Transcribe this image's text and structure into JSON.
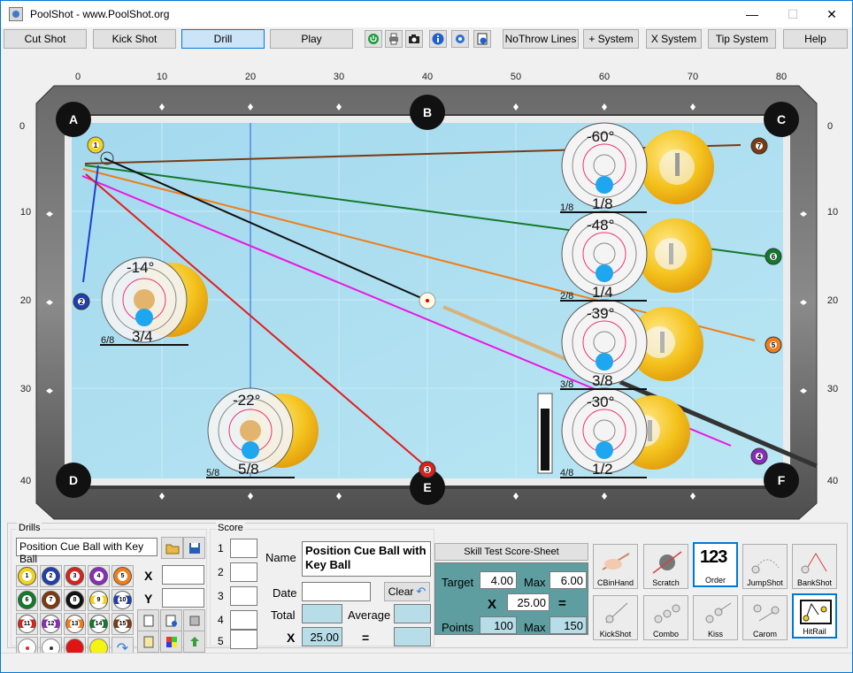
{
  "window": {
    "title": "PoolShot - www.PoolShot.org",
    "minimize": "—",
    "maximize": "☐",
    "close": "✕"
  },
  "toolbar": {
    "buttons": [
      "Cut Shot",
      "Kick Shot",
      "Drill",
      "Play"
    ],
    "active": "Drill",
    "icons": [
      "power-icon",
      "printer-icon",
      "camera-icon",
      "info-icon",
      "settings-icon",
      "help-document-icon"
    ],
    "right_buttons": [
      "NoThrow Lines",
      "+ System",
      "X System",
      "Tip System",
      "Help"
    ]
  },
  "table": {
    "top_ruler": [
      "0",
      "10",
      "20",
      "30",
      "40",
      "50",
      "60",
      "70",
      "80"
    ],
    "left_ruler": [
      "0",
      "10",
      "20",
      "30",
      "40"
    ],
    "right_ruler": [
      "0",
      "10",
      "20",
      "30",
      "40"
    ],
    "pockets": [
      "A",
      "B",
      "C",
      "D",
      "E",
      "F"
    ],
    "balls": [
      {
        "num": "1",
        "color": "#f2d31b"
      },
      {
        "num": "7",
        "color": "#7a3b12"
      },
      {
        "num": "6",
        "color": "#127a2b"
      },
      {
        "num": "2",
        "color": "#1f3fae"
      },
      {
        "num": "5",
        "color": "#f07d17"
      },
      {
        "num": "4",
        "color": "#8b2bbd"
      },
      {
        "num": "3",
        "color": "#d8231d"
      }
    ],
    "aims": [
      {
        "angle": "-60°",
        "frac": "1/8",
        "small": "1/8"
      },
      {
        "angle": "-48°",
        "frac": "1/4",
        "small": "2/8"
      },
      {
        "angle": "-39°",
        "frac": "3/8",
        "small": "3/8"
      },
      {
        "angle": "-30°",
        "frac": "1/2",
        "small": "4/8"
      },
      {
        "angle": "-14°",
        "frac": "3/4",
        "small": "6/8"
      },
      {
        "angle": "-22°",
        "frac": "5/8",
        "small": "5/8"
      }
    ]
  },
  "drills": {
    "group_label": "Drills",
    "drill_name": "Position Cue Ball with Key Ball",
    "x_label": "X",
    "y_label": "Y",
    "balls": [
      "1",
      "2",
      "3",
      "4",
      "5",
      "6",
      "7",
      "8",
      "9",
      "10",
      "11",
      "12",
      "13",
      "14",
      "15"
    ]
  },
  "score": {
    "group_label": "Score",
    "rows": [
      "1",
      "2",
      "3",
      "4",
      "5"
    ],
    "name_label": "Name",
    "name_value": "Position Cue Ball with Key Ball",
    "date_label": "Date",
    "clear_label": "Clear",
    "total_label": "Total",
    "average_label": "Average",
    "x_label": "X",
    "multiplier": "25.00",
    "equals": "="
  },
  "skill": {
    "sheet_button": "Skill Test Score-Sheet",
    "target_label": "Target",
    "target_value": "4.00",
    "max_label": "Max",
    "max_value": "6.00",
    "x_label": "X",
    "x_value": "25.00",
    "equals": "=",
    "points_label": "Points",
    "points_value": "100",
    "max2_label": "Max",
    "points_max": "150"
  },
  "modes": [
    {
      "label": "CBinHand",
      "selected": false
    },
    {
      "label": "Scratch",
      "selected": false
    },
    {
      "label": "Order",
      "selected": true,
      "glyph": "123"
    },
    {
      "label": "JumpShot",
      "selected": false
    },
    {
      "label": "BankShot",
      "selected": false
    },
    {
      "label": "KickShot",
      "selected": false
    },
    {
      "label": "Combo",
      "selected": false
    },
    {
      "label": "Kiss",
      "selected": false
    },
    {
      "label": "Carom",
      "selected": false
    },
    {
      "label": "HitRail",
      "selected": true
    }
  ],
  "colors": {
    "felt": "#a8dcef",
    "rail": "#5e5e5e",
    "teal": "#5e9ea0",
    "accent": "#0078d7"
  }
}
